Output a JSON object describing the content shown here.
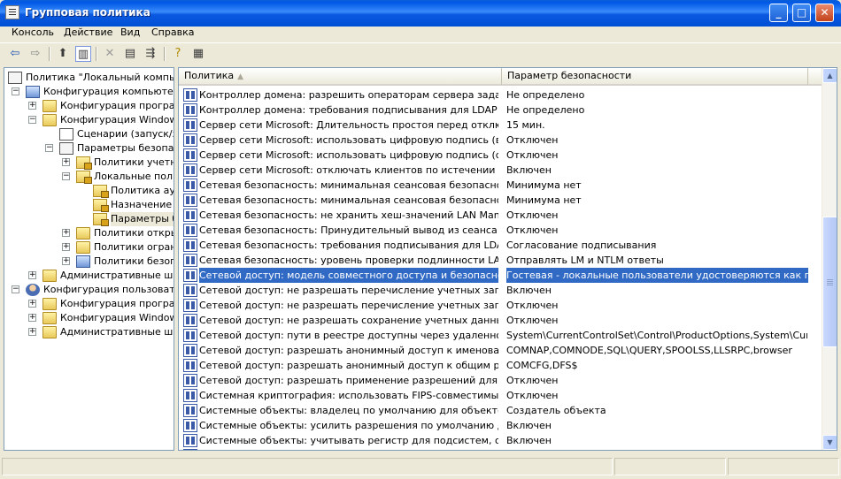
{
  "window": {
    "title": "Групповая политика"
  },
  "menu": [
    "Консоль",
    "Действие",
    "Вид",
    "Справка"
  ],
  "toolbar": [
    "back-icon",
    "forward-icon",
    "up-folder-icon",
    "show-hide-tree-icon",
    "delete-icon",
    "properties-icon",
    "export-list-icon",
    "help-icon",
    "console-tree-icon"
  ],
  "tree": [
    {
      "label": "Политика \"Локальный компьютер\"",
      "icon": "group-policy-icon"
    },
    {
      "label": "Конфигурация компьютера",
      "icon": "computer-icon"
    },
    {
      "label": "Конфигурация программ",
      "icon": "folder-icon"
    },
    {
      "label": "Конфигурация Windows",
      "icon": "folder-icon"
    },
    {
      "label": "Сценарии (запуск/завершение)",
      "icon": "script-icon"
    },
    {
      "label": "Параметры безопасности",
      "icon": "security-settings-icon"
    },
    {
      "label": "Политики учетных записей",
      "icon": "secure-folder-icon"
    },
    {
      "label": "Локальные политики",
      "icon": "secure-folder-icon"
    },
    {
      "label": "Политика аудита",
      "icon": "secure-folder-icon"
    },
    {
      "label": "Назначение прав пользователя",
      "icon": "secure-folder-icon"
    },
    {
      "label": "Параметры безопасности",
      "icon": "secure-folder-icon"
    },
    {
      "label": "Политики открытого ключа",
      "icon": "folder-icon"
    },
    {
      "label": "Политики ограниченного использования программ",
      "icon": "folder-icon"
    },
    {
      "label": "Политики безопасности IP",
      "icon": "ip-security-icon"
    },
    {
      "label": "Административные шаблоны",
      "icon": "folder-icon"
    },
    {
      "label": "Конфигурация пользователя",
      "icon": "user-icon"
    },
    {
      "label": "Конфигурация программ",
      "icon": "folder-icon"
    },
    {
      "label": "Конфигурация Windows",
      "icon": "folder-icon"
    },
    {
      "label": "Административные шаблоны",
      "icon": "folder-icon"
    }
  ],
  "list": {
    "columns": [
      "Политика",
      "Параметр безопасности"
    ],
    "rows": [
      {
        "policy": "Контроллер домена: разрешить операторам сервера задавать выполнение заданий",
        "value": "Не определено"
      },
      {
        "policy": "Контроллер домена: требования подписывания для LDAP сервера",
        "value": "Не определено"
      },
      {
        "policy": "Сервер сети Microsoft: Длительность простоя перед отключением сеанса",
        "value": "15 мин."
      },
      {
        "policy": "Сервер сети Microsoft: использовать цифровую подпись (всегда)",
        "value": "Отключен"
      },
      {
        "policy": "Сервер сети Microsoft: использовать цифровую подпись (с согласия клиента)",
        "value": "Отключен"
      },
      {
        "policy": "Сервер сети Microsoft: отключать клиентов по истечении разрешенных часов входа",
        "value": "Включен"
      },
      {
        "policy": "Сетевая безопасность: минимальная сеансовая безопасность для клиентов",
        "value": "Минимума нет"
      },
      {
        "policy": "Сетевая безопасность: минимальная сеансовая безопасность для серверов",
        "value": "Минимума нет"
      },
      {
        "policy": "Сетевая безопасность: не хранить хеш-значений LAN Manager при следующей смене пароля",
        "value": "Отключен"
      },
      {
        "policy": "Сетевая безопасность: Принудительный вывод из сеанса по истечении допустимых часов работы",
        "value": "Отключен"
      },
      {
        "policy": "Сетевая безопасность: требования подписывания для LDAP клиента",
        "value": "Согласование подписывания"
      },
      {
        "policy": "Сетевая безопасность: уровень проверки подлинности LAN Manager",
        "value": "Отправлять LM и NTLM ответы"
      },
      {
        "policy": "Сетевой доступ: модель совместного доступа и безопасности для локальных учетных записей",
        "value": "Гостевая - локальные пользователи удостоверяются как гости"
      },
      {
        "policy": "Сетевой доступ: не разрешать перечисление учетных записей SAM анонимными пользователями",
        "value": "Включен"
      },
      {
        "policy": "Сетевой доступ: не разрешать перечисление учетных записей SAM и общих ресурсов",
        "value": "Отключен"
      },
      {
        "policy": "Сетевой доступ: не разрешать сохранение учетных данных или цифровых паспортов",
        "value": "Отключен"
      },
      {
        "policy": "Сетевой доступ: пути в реестре доступны через удаленное подключение",
        "value": "System\\CurrentControlSet\\Control\\ProductOptions,System\\CurrentControlSet"
      },
      {
        "policy": "Сетевой доступ: разрешать анонимный доступ к именованным каналам",
        "value": "COMNAP,COMNODE,SQL\\QUERY,SPOOLSS,LLSRPC,browser"
      },
      {
        "policy": "Сетевой доступ: разрешать анонимный доступ к общим ресурсам",
        "value": "COMCFG,DFS$"
      },
      {
        "policy": "Сетевой доступ: разрешать применение разрешений для всех к анонимным пользователям",
        "value": "Отключен"
      },
      {
        "policy": "Системная криптография: использовать FIPS-совместимые алгоритмы",
        "value": "Отключен"
      },
      {
        "policy": "Системные объекты: владелец по умолчанию для объектов, созданных членами группы",
        "value": "Создатель объекта"
      },
      {
        "policy": "Системные объекты: усилить разрешения по умолчанию для внутренних объектов",
        "value": "Включен"
      },
      {
        "policy": "Системные объекты: учитывать регистр для подсистем, отличных от Windows",
        "value": "Включен"
      },
      {
        "policy": "",
        "value": ""
      }
    ],
    "selected_index": 12
  }
}
